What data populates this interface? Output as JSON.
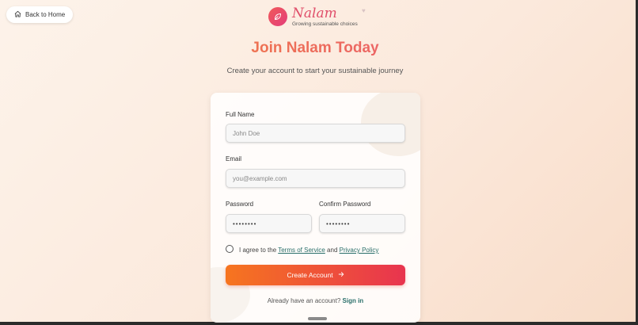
{
  "nav": {
    "back_label": "Back to Home"
  },
  "brand": {
    "name": "Nalam",
    "tagline": "Growing sustainable choices",
    "accent": "#e04e6a"
  },
  "page": {
    "title": "Join Nalam Today",
    "subtitle": "Create your account to start your sustainable journey"
  },
  "form": {
    "full_name": {
      "label": "Full Name",
      "placeholder": "John Doe"
    },
    "email": {
      "label": "Email",
      "placeholder": "you@example.com"
    },
    "password": {
      "label": "Password",
      "value": "••••••••"
    },
    "confirm_password": {
      "label": "Confirm Password",
      "value": "••••••••"
    },
    "agree": {
      "prefix": "I agree to the",
      "terms": "Terms of Service",
      "and": "and",
      "privacy": "Privacy Policy"
    },
    "submit_label": "Create Account",
    "signin": {
      "prompt": "Already have an account?",
      "link": "Sign in"
    }
  },
  "colors": {
    "button_start": "#f6751f",
    "button_end": "#e8344f",
    "link": "#2a6f6a"
  }
}
